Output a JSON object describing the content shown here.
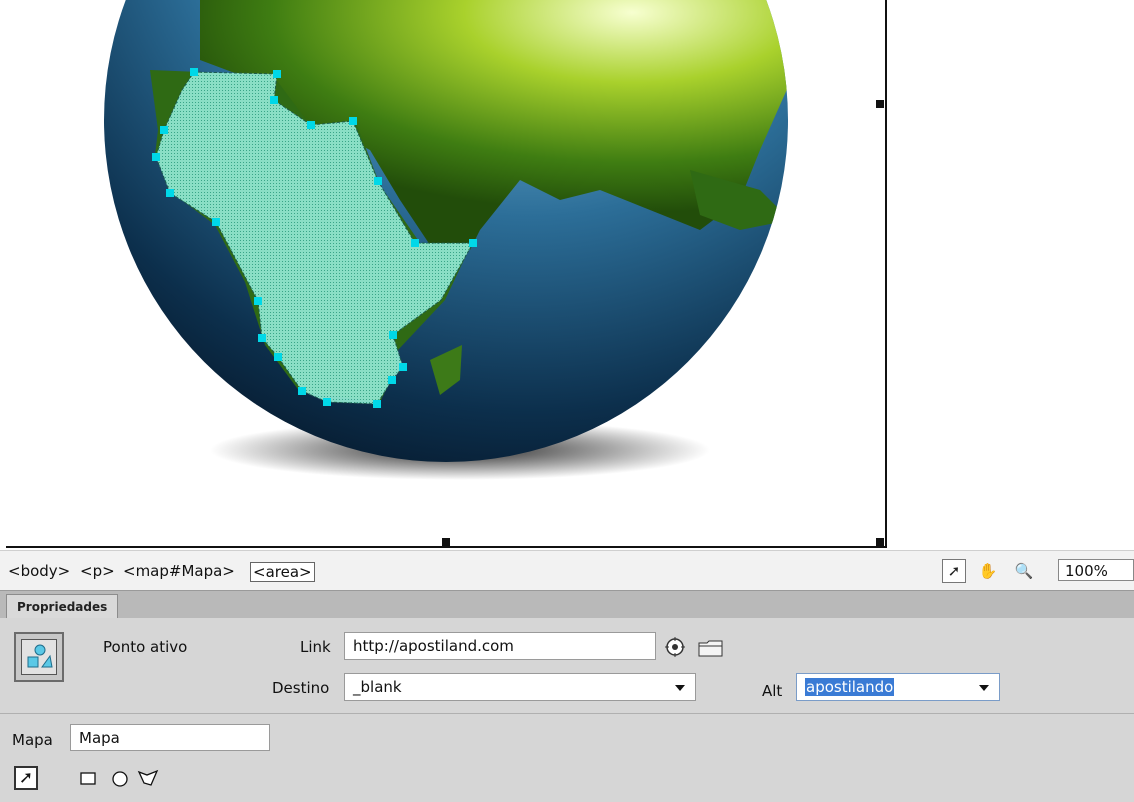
{
  "breadcrumb": {
    "tags": [
      "<body>",
      "<p>",
      "<map#Mapa>",
      "<area>"
    ]
  },
  "view_tools": {
    "zoom_value": "100%",
    "icons": [
      "pointer-icon",
      "hand-icon",
      "zoom-icon"
    ]
  },
  "panel": {
    "tab_label": "Propriedades"
  },
  "properties": {
    "type_label": "Ponto ativo",
    "link_label": "Link",
    "link_value": "http://apostiland.com",
    "target_label": "Destino",
    "target_value": "_blank",
    "alt_label": "Alt",
    "alt_value": "apostilando",
    "map_label": "Mapa",
    "map_value": "Mapa"
  },
  "map_tools": {
    "icons": [
      "pointer-hotspot-icon",
      "rectangle-hotspot-icon",
      "oval-hotspot-icon",
      "polygon-hotspot-icon"
    ]
  },
  "colors": {
    "hotspot_fill": "#7fe0c8",
    "hotspot_handle": "#00d8e8",
    "selection_blue": "#3a7bd5"
  }
}
